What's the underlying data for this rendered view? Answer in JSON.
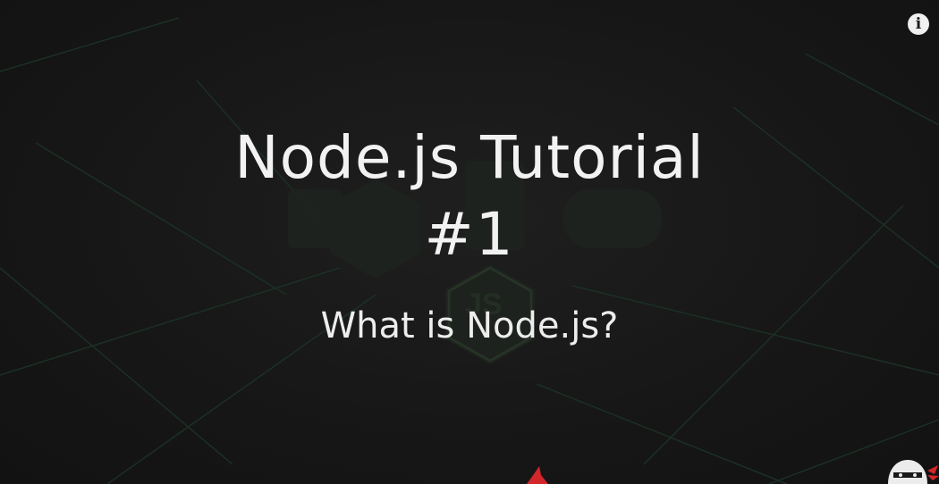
{
  "video": {
    "title": "Node.js Tutorial",
    "episode": "#1",
    "subtitle": "What is Node.js?"
  },
  "overlay": {
    "info_button_label": "i",
    "info_icon": "info-icon",
    "channel_logo_icon": "ninja-logo-icon"
  },
  "colors": {
    "background": "#161616",
    "text": "#f2f2f2",
    "watermark_green": "#3f7f4a",
    "accent_red": "#d3262a"
  }
}
